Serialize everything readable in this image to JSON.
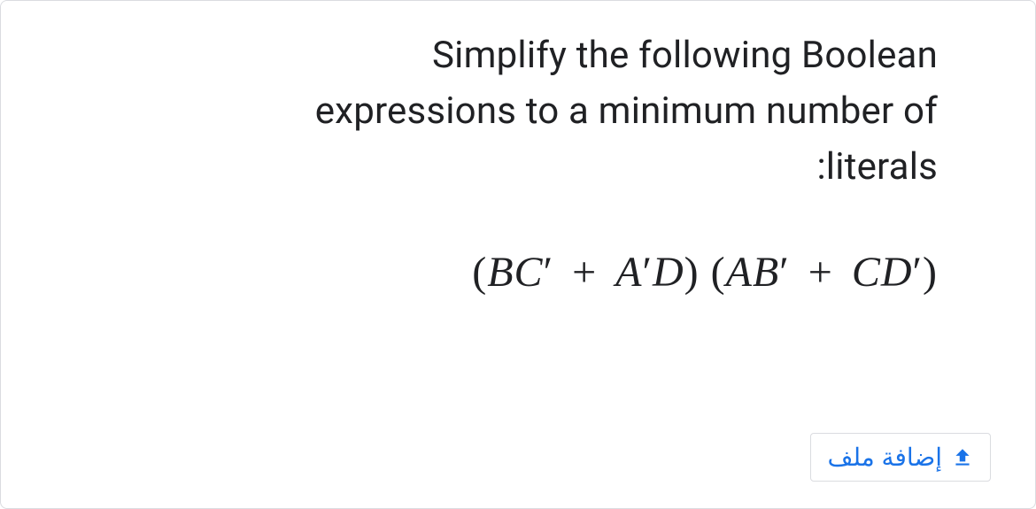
{
  "question": {
    "line1": "Simplify the following Boolean",
    "line2": "expressions to a minimum number of",
    "line3": ":literals"
  },
  "expression": {
    "term1_open": "(",
    "term1_a": "BC",
    "term1_a_prime": "′",
    "term1_plus": " + ",
    "term1_b": "A",
    "term1_b_prime": "′",
    "term1_c": "D",
    "term1_close": ") ",
    "term2_open": "(",
    "term2_a": "AB",
    "term2_a_prime": "′",
    "term2_plus": " + ",
    "term2_b": "CD",
    "term2_b_prime": "′",
    "term2_close": ")"
  },
  "upload": {
    "label": "إضافة ملف"
  }
}
